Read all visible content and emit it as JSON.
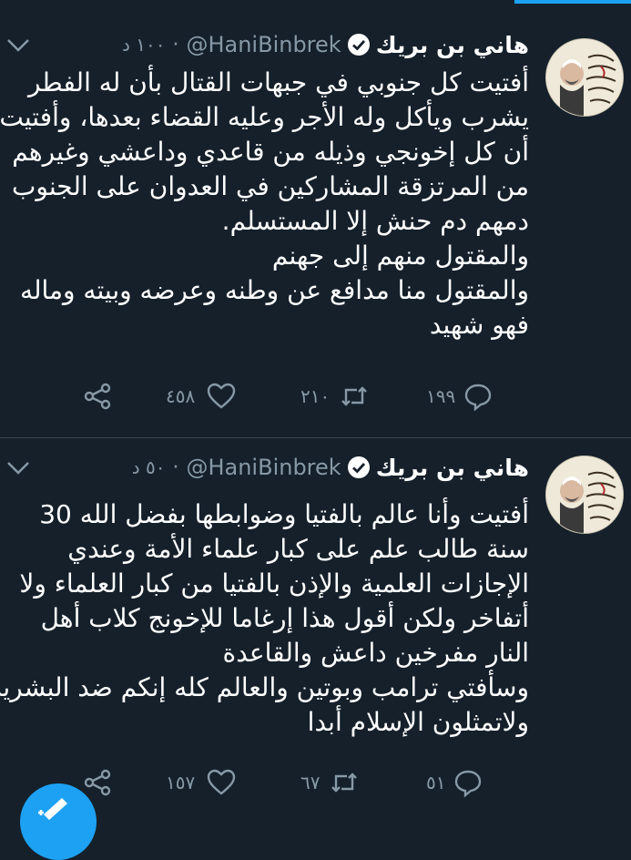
{
  "tweets": [
    {
      "name": "هاني بن بريك",
      "handle": "@HaniBinbrek",
      "separator": "·",
      "time": "١٠٠ د",
      "lines": [
        "أفتيت كل جنوبي في جبهات القتال بأن له الفطر",
        "يشرب ويأكل وله الأجر وعليه القضاء بعدها، وأفتيت",
        "أن كل إخونجي وذيله من قاعدي وداعشي وغيرهم",
        "من المرتزقة المشاركين في العدوان على الجنوب",
        "دمهم دم حنش إلا المستسلم.",
        "والمقتول منهم إلى جهنم",
        "والمقتول منا مدافع عن وطنه وعرضه وبيته وماله",
        "فهو شهيد"
      ],
      "replies": "١٩٩",
      "retweets": "٢١٠",
      "likes": "٤٥٨"
    },
    {
      "name": "هاني بن بريك",
      "handle": "@HaniBinbrek",
      "separator": "·",
      "time": "٥٠ د",
      "lines": [
        "أفتيت وأنا عالم بالفتيا وضوابطها بفضل الله 30",
        "سنة طالب علم على كبار علماء الأمة وعندي",
        "الإجازات العلمية والإذن بالفتيا من كبار العلماء ولا",
        "أتفاخر ولكن أقول هذا إرغاما للإخونج كلاب أهل",
        "النار مفرخين داعش والقاعدة",
        "وسأفتي ترامب وبوتين والعالم كله إنكم ضد البشرية",
        "ولاتمثلون الإسلام أبدا"
      ],
      "replies": "٥١",
      "retweets": "٦٧",
      "likes": "١٥٧"
    }
  ],
  "icons": {
    "verified": "verified-badge-icon",
    "more": "chevron-down-icon",
    "reply": "reply-icon",
    "retweet": "retweet-icon",
    "like": "heart-icon",
    "share": "share-icon",
    "compose": "compose-tweet-icon"
  },
  "colors": {
    "background": "#15202b",
    "accent": "#1da1f2",
    "secondary_text": "#8899a6",
    "divider": "#38444d"
  }
}
